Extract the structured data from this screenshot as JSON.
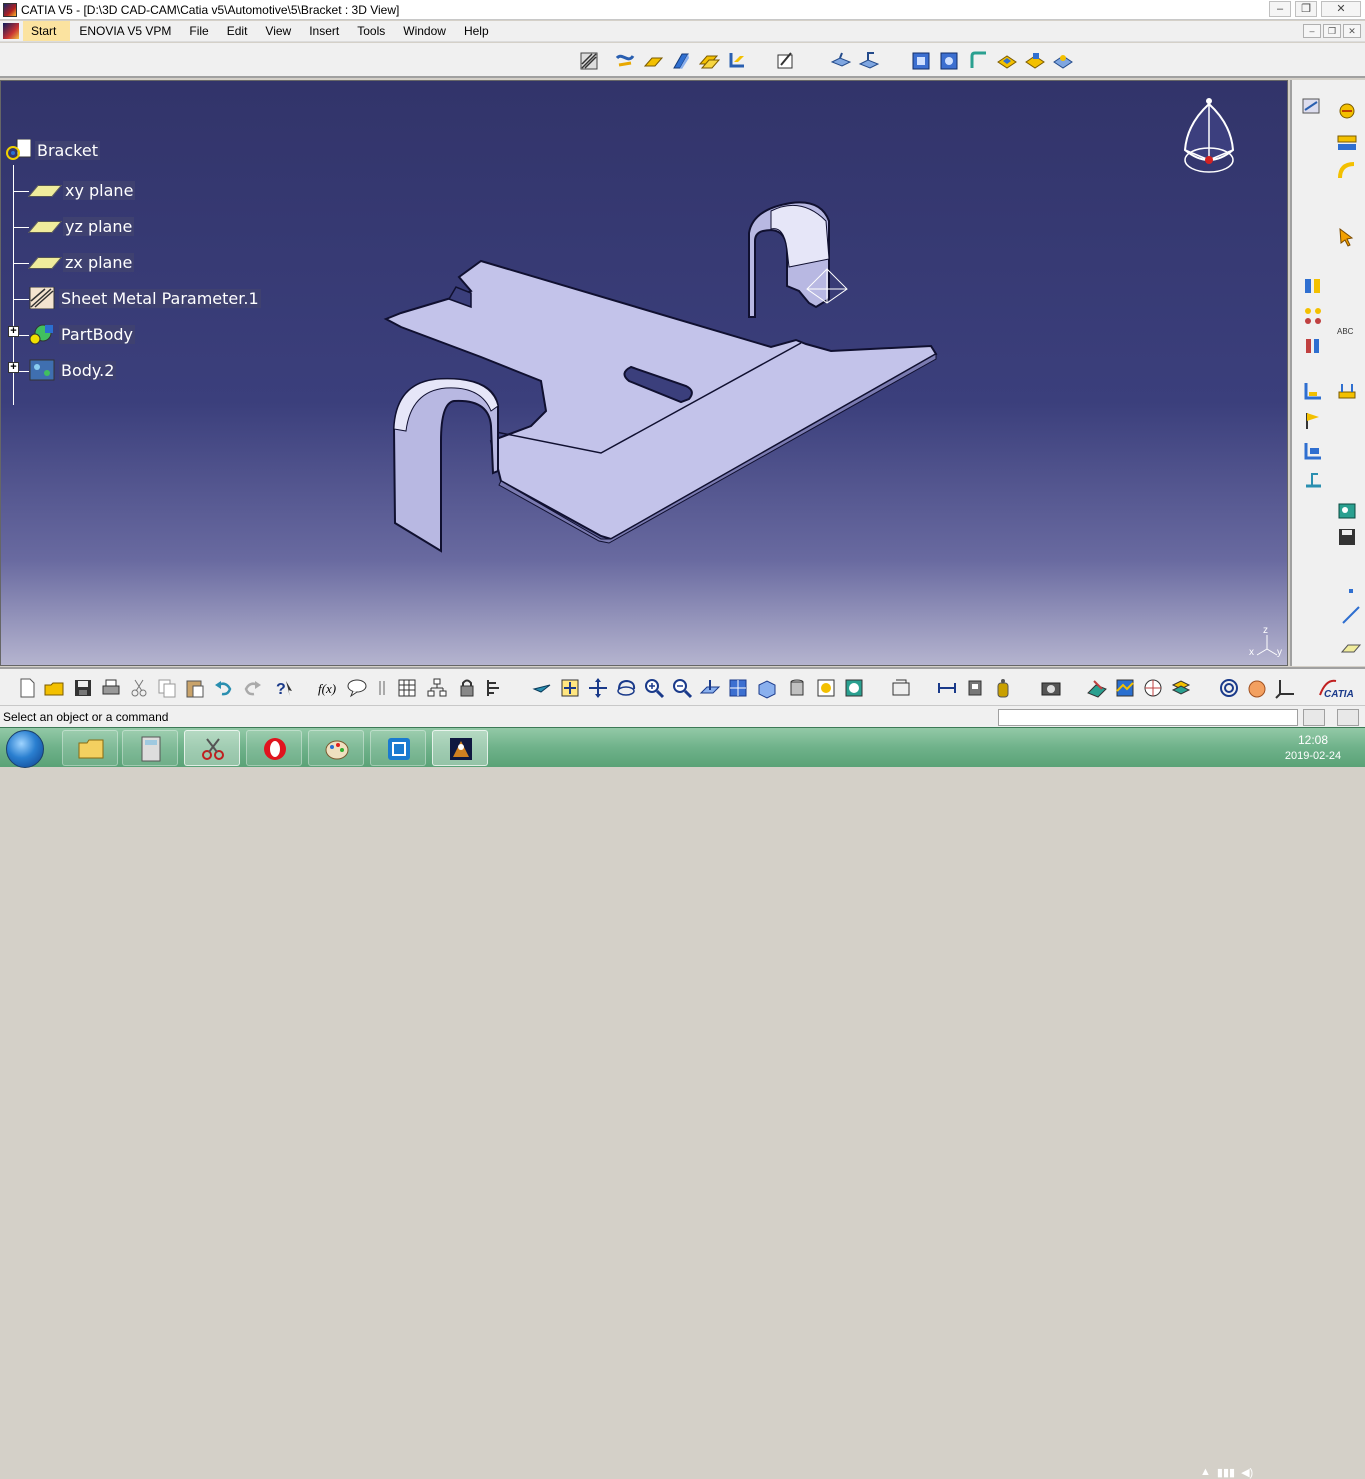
{
  "window": {
    "title": "CATIA V5 - [D:\\3D CAD-CAM\\Catia v5\\Automotive\\5\\Bracket : 3D View]",
    "minimize": "–",
    "restore": "❐",
    "close": "✕"
  },
  "menu": {
    "items": [
      "Start",
      "ENOVIA V5 VPM",
      "File",
      "Edit",
      "View",
      "Insert",
      "Tools",
      "Window",
      "Help"
    ]
  },
  "tree": {
    "root": "Bracket",
    "nodes": [
      "xy plane",
      "yz plane",
      "zx plane",
      "Sheet Metal Parameter.1",
      "PartBody",
      "Body.2"
    ],
    "expanders": [
      "+",
      "+"
    ]
  },
  "compass": {
    "axis_x": "x",
    "axis_y": "y",
    "axis_z": "z"
  },
  "status": {
    "message": "Select an object or a command",
    "command_value": ""
  },
  "taskbar": {
    "time": "12:08",
    "date": "2019-02-24"
  },
  "colors": {
    "viewport_top": "#32346a",
    "viewport_bottom": "#b5b4cf",
    "part_face": "#c3c3ea",
    "start_highlight": "#fbe3a0",
    "taskbar": "#6fb28a"
  },
  "icons": {
    "top_toolbar": [
      "sheet-metal-parameters-icon",
      "wall-icon",
      "flange-icon",
      "extrusion-icon",
      "swept-wall-icon",
      "hem-icon",
      "sketch-icon",
      "unfold-icon",
      "fold-icon",
      "cut-out-icon",
      "hole-icon",
      "corner-icon",
      "stamp-icon",
      "pattern-icon"
    ],
    "bottom_toolbar": [
      "new-icon",
      "open-icon",
      "save-icon",
      "print-icon",
      "cut-icon",
      "copy-icon",
      "paste-icon",
      "undo-icon",
      "redo-icon",
      "whats-this-icon",
      "formula-icon",
      "knowledge-icon",
      "fly-mode-icon",
      "fit-all-icon",
      "pan-icon",
      "rotate-icon",
      "zoom-in-icon",
      "zoom-out-icon",
      "normal-view-icon",
      "multi-view-icon",
      "iso-view-icon",
      "shading-icon",
      "hide-show-icon",
      "swap-space-icon",
      "measure-icon",
      "catia-logo"
    ],
    "right_toolbar": [
      "sketcher-icon",
      "bounding-icon",
      "point-icon",
      "line-icon",
      "plane-icon"
    ]
  }
}
